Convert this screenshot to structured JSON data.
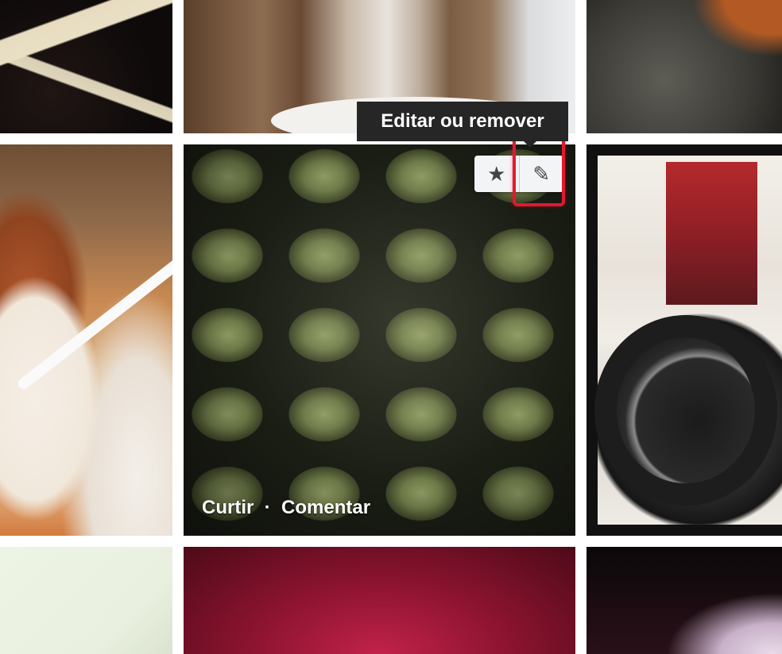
{
  "tooltip": {
    "text": "Editar ou remover"
  },
  "toolbar": {
    "favorite_glyph": "★",
    "edit_glyph": "✎"
  },
  "photo_actions": {
    "like": "Curtir",
    "separator": "·",
    "comment": "Comentar"
  }
}
